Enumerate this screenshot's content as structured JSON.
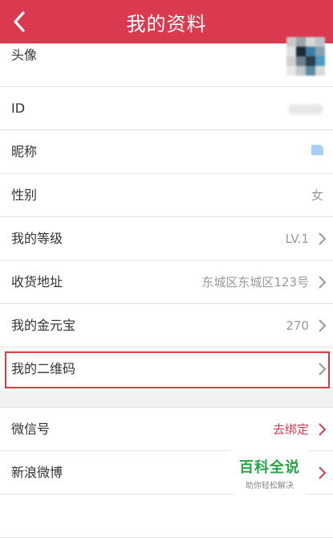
{
  "header": {
    "title": "我的资料"
  },
  "profile": [
    {
      "label": "头像"
    },
    {
      "label": "ID"
    },
    {
      "label": "昵称"
    },
    {
      "label": "性别",
      "value": "女"
    },
    {
      "label": "我的等级",
      "value": "LV.1"
    },
    {
      "label": "收货地址",
      "value": "东城区东城区123号"
    },
    {
      "label": "我的金元宝",
      "value": "270"
    },
    {
      "label": "我的二维码"
    }
  ],
  "social": [
    {
      "label": "微信号",
      "value": "去绑定"
    },
    {
      "label": "新浪微博"
    }
  ],
  "watermark": {
    "main": "百科全说",
    "sub": "助你轻松解决"
  },
  "colors": {
    "accent": "#d93a4f",
    "highlight": "#e0383e",
    "watermark": "#25a546"
  }
}
